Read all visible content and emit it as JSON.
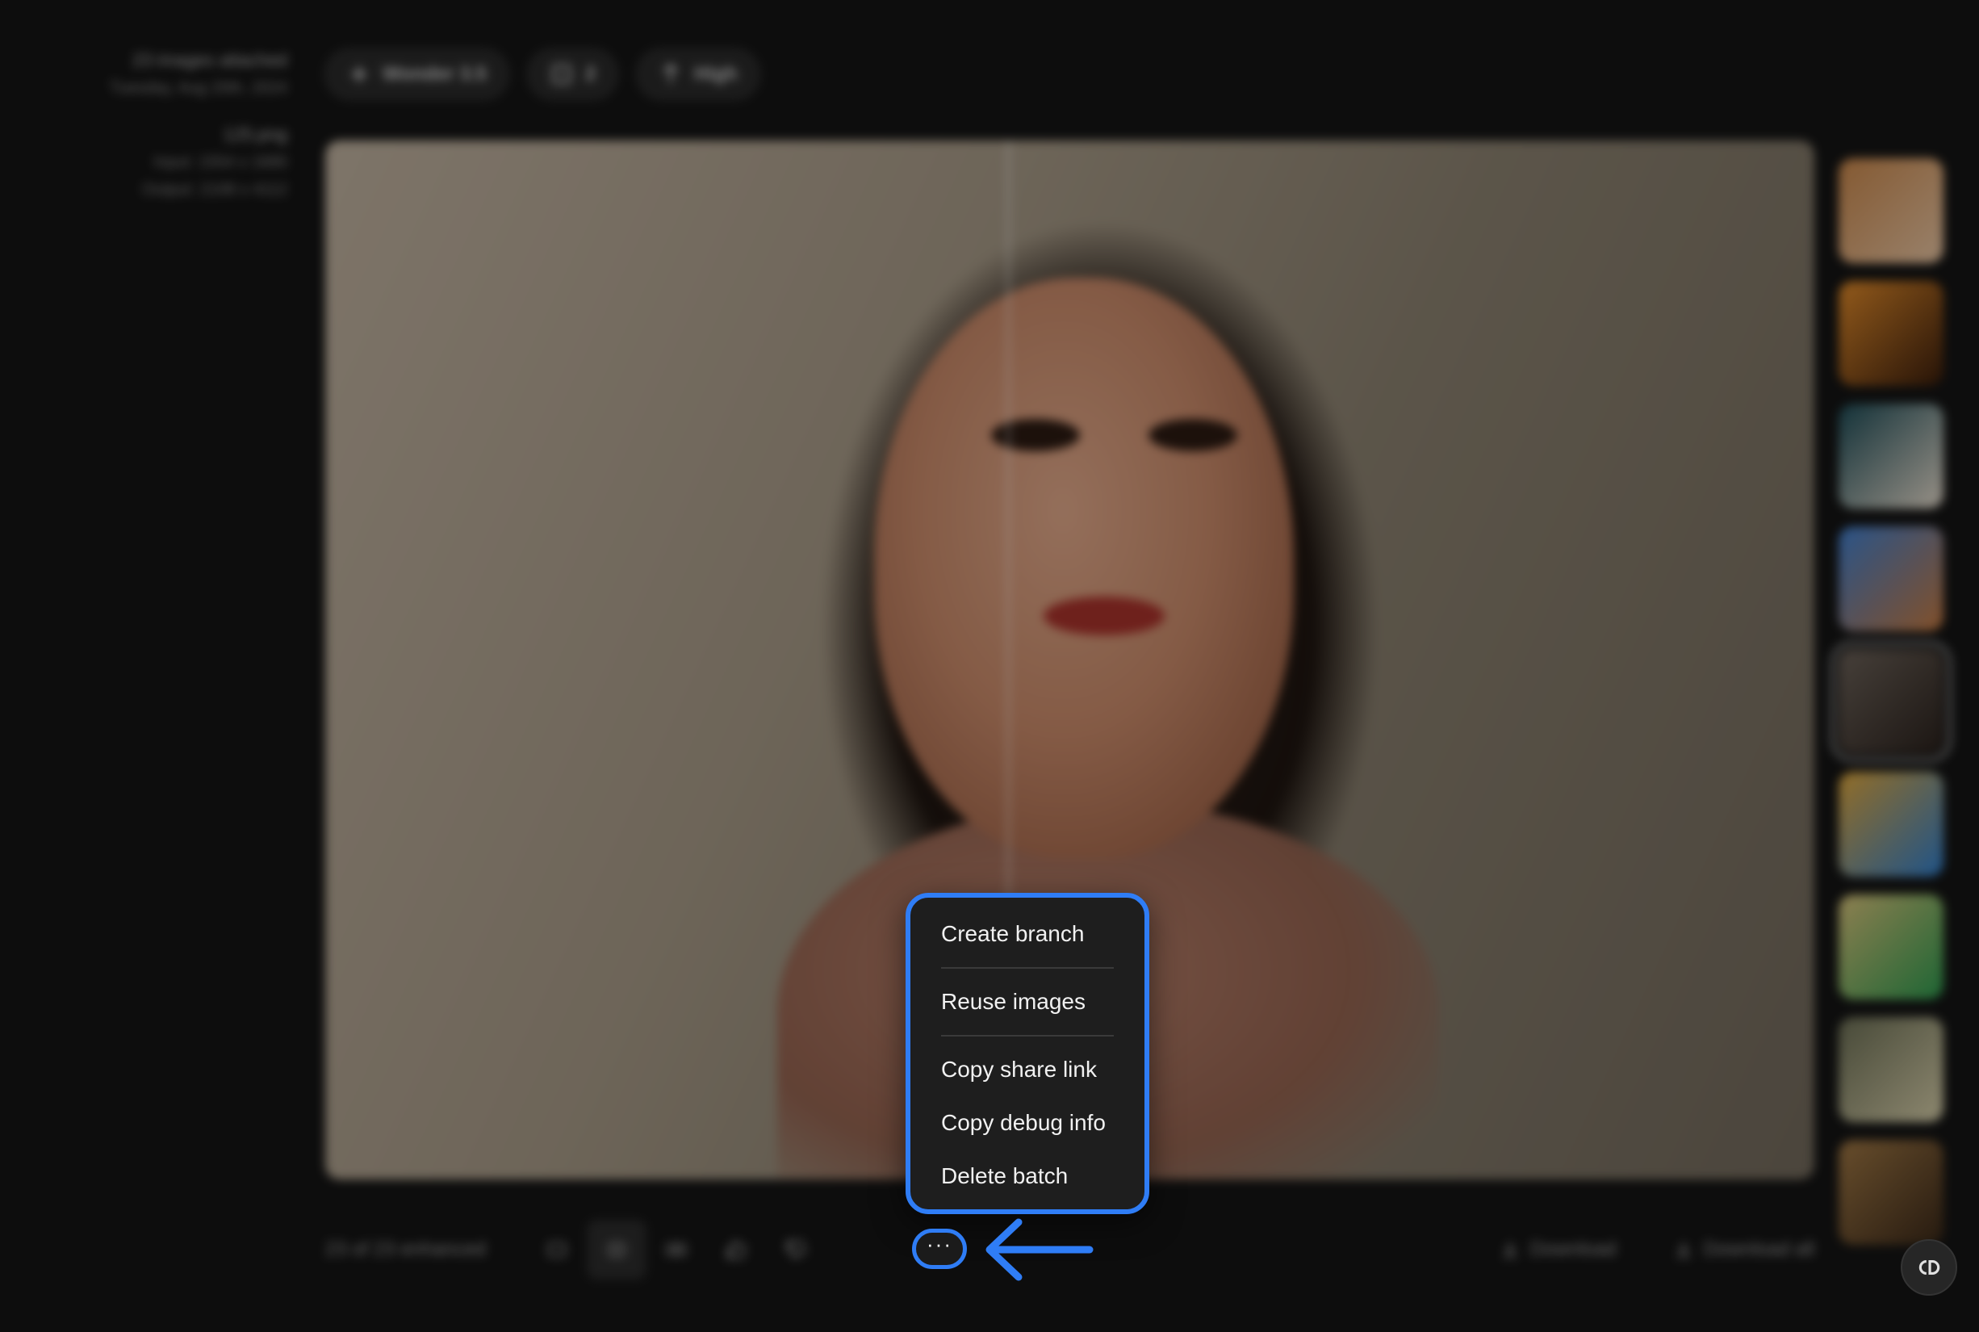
{
  "left_panel": {
    "batch_title": "23 images attached",
    "batch_date": "Tuesday, Aug 20th, 2024",
    "file_name": "125.png",
    "input_size": "Input: 1554 x 1680",
    "output_size": "Output: 2108 x 4112"
  },
  "top_pills": {
    "model": "Wonder 3.5",
    "scale": "2",
    "quality": "High"
  },
  "thumbnails": [
    {
      "colors": [
        "#c9874b",
        "#e9c6a4"
      ]
    },
    {
      "colors": [
        "#e08a2a",
        "#3a1d0c"
      ]
    },
    {
      "colors": [
        "#1c4b56",
        "#e7dccd"
      ]
    },
    {
      "colors": [
        "#3f7fd0",
        "#c77a3f"
      ]
    },
    {
      "colors": [
        "#6c6259",
        "#2a211c"
      ],
      "selected": true
    },
    {
      "colors": [
        "#e0a73b",
        "#2f7fd0"
      ]
    },
    {
      "colors": [
        "#d8c27b",
        "#2d9b4f"
      ]
    },
    {
      "colors": [
        "#6c6f55",
        "#d7cfaa"
      ]
    },
    {
      "colors": [
        "#9f7744",
        "#3a2818"
      ]
    }
  ],
  "bottom_bar": {
    "status": "23 of 23 enhanced",
    "download_label": "Download",
    "download_all_label": "Download all"
  },
  "more_button": {
    "glyph": "···"
  },
  "menu": {
    "items": [
      {
        "label": "Create branch"
      },
      {
        "label": "Reuse images"
      },
      {
        "label": "Copy share link"
      },
      {
        "label": "Copy debug info"
      },
      {
        "label": "Delete batch"
      }
    ]
  },
  "colors": {
    "highlight": "#2f7df6",
    "background": "#151515",
    "menu_background": "#1e1e1e"
  }
}
